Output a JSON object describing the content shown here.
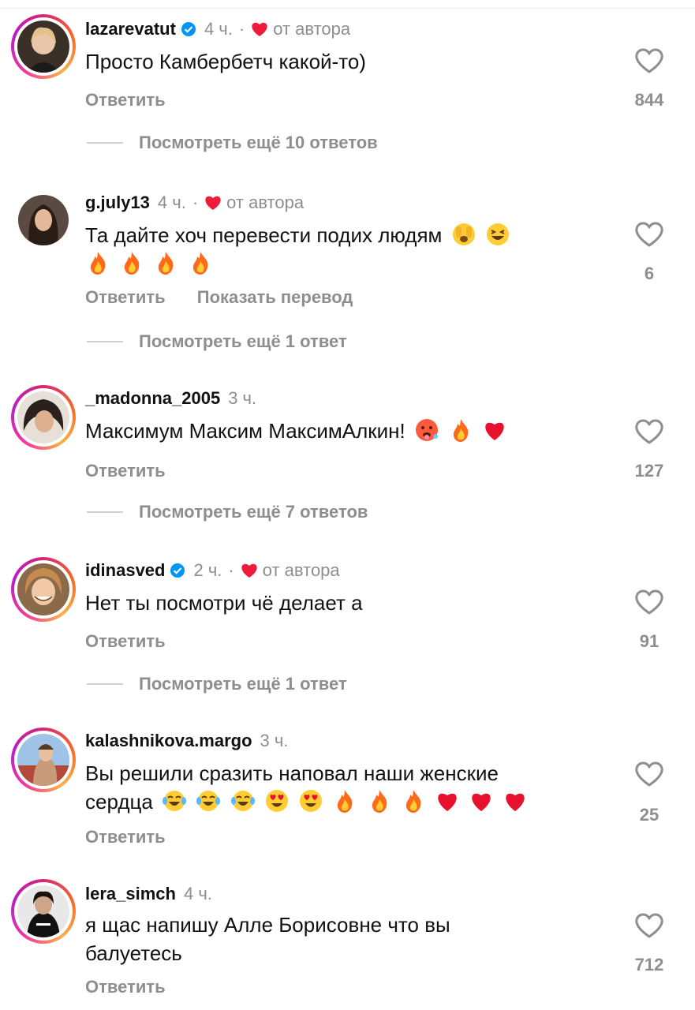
{
  "comments": [
    {
      "username": "lazarevatut",
      "verified": true,
      "time": "4 ч.",
      "author_like": "от автора",
      "text": "Просто Камбербетч какой-то)",
      "emojis": [],
      "likes": "844",
      "reply": "Ответить",
      "translate": "",
      "more_replies": "Посмотреть ещё 10 ответов",
      "avatar_color": "#c9a26f"
    },
    {
      "username": "g.july13",
      "verified": false,
      "time": "4 ч.",
      "author_like": "от автора",
      "text": "Та дайте хоч перевести подих людям",
      "emojis": [
        "face-peeking-emoji",
        "grinning-squint-emoji"
      ],
      "line2_emojis": [
        "fire-emoji",
        "fire-emoji",
        "fire-emoji",
        "fire-emoji"
      ],
      "likes": "6",
      "reply": "Ответить",
      "translate": "Показать перевод",
      "more_replies": "Посмотреть ещё 1 ответ",
      "avatar_color": "#4a3a30"
    },
    {
      "username": "_madonna_2005",
      "verified": false,
      "time": "3 ч.",
      "author_like": "",
      "text": "Максимум Максим МаксимАлкин!",
      "emojis": [
        "hot-face-emoji",
        "fire-emoji",
        "red-heart-emoji"
      ],
      "likes": "127",
      "reply": "Ответить",
      "translate": "",
      "more_replies": "Посмотреть ещё 7 ответов",
      "avatar_color": "#d8d0c4"
    },
    {
      "username": "idinasved",
      "verified": true,
      "time": "2 ч.",
      "author_like": "от автора",
      "text": "Нет ты посмотри чё делает а",
      "emojis": [],
      "likes": "91",
      "reply": "Ответить",
      "translate": "",
      "more_replies": "Посмотреть ещё 1 ответ",
      "avatar_color": "#b8794a"
    },
    {
      "username": "kalashnikova.margo",
      "verified": false,
      "time": "3 ч.",
      "author_like": "",
      "text": "Вы решили сразить наповал наши женские",
      "text_line2": "сердца",
      "line2_emojis": [
        "tears-of-joy-emoji",
        "tears-of-joy-emoji",
        "tears-of-joy-emoji",
        "heart-eyes-emoji",
        "heart-eyes-emoji",
        "fire-emoji",
        "fire-emoji",
        "fire-emoji",
        "red-heart-emoji",
        "red-heart-emoji",
        "red-heart-emoji"
      ],
      "likes": "25",
      "reply": "Ответить",
      "translate": "",
      "more_replies": "",
      "avatar_color": "#7aa0c8"
    },
    {
      "username": "lera_simch",
      "verified": false,
      "time": "4 ч.",
      "author_like": "",
      "text": "я щас напишу Алле Борисовне что вы",
      "text_line2": "балуетесь",
      "likes": "712",
      "reply": "Ответить",
      "translate": "",
      "more_replies": "",
      "avatar_color": "#2a2a2a"
    }
  ],
  "colors": {
    "text_primary": "#111111",
    "text_secondary": "#8e8e8e",
    "heart_red": "#ed1c3a",
    "verified_blue": "#0095f6"
  }
}
